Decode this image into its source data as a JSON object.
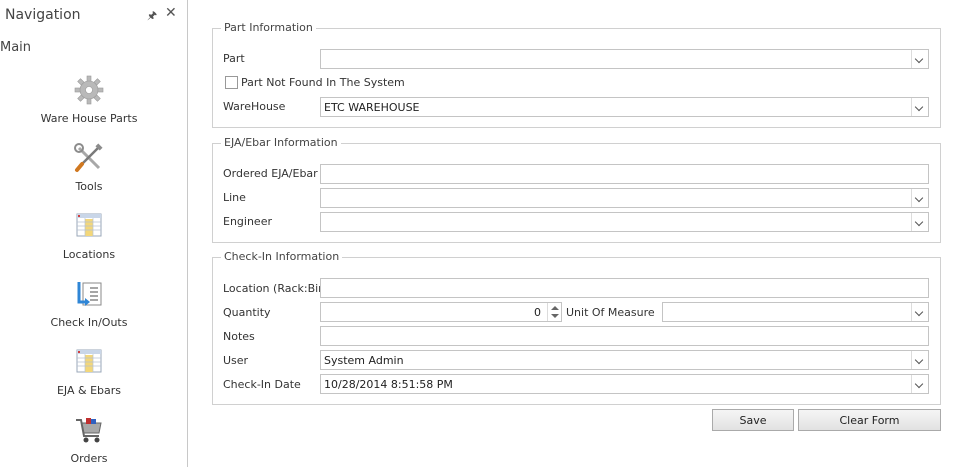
{
  "navigation": {
    "title": "Navigation",
    "group": "Main",
    "items": [
      {
        "label": "Ware House Parts",
        "icon": "gear-icon"
      },
      {
        "label": "Tools",
        "icon": "tools-icon"
      },
      {
        "label": "Locations",
        "icon": "grid-table-icon"
      },
      {
        "label": "Check In/Outs",
        "icon": "check-in-out-icon"
      },
      {
        "label": "EJA & Ebars",
        "icon": "grid-table-icon"
      },
      {
        "label": "Orders",
        "icon": "shopping-cart-icon"
      }
    ]
  },
  "part_info": {
    "title": "Part Information",
    "part_label": "Part",
    "part_value": "",
    "not_found_label": "Part Not Found In The System",
    "not_found_checked": false,
    "warehouse_label": "WareHouse",
    "warehouse_value": "ETC WAREHOUSE"
  },
  "eja_info": {
    "title": "EJA/Ebar Information",
    "ordered_label": "Ordered EJA/Ebar",
    "ordered_value": "",
    "line_label": "Line",
    "line_value": "",
    "engineer_label": "Engineer",
    "engineer_value": ""
  },
  "checkin_info": {
    "title": "Check-In Information",
    "location_label": "Location (Rack:Bin)",
    "location_value": "",
    "quantity_label": "Quantity",
    "quantity_value": "0",
    "uom_label": "Unit Of Measure",
    "uom_value": "",
    "notes_label": "Notes",
    "notes_value": "",
    "user_label": "User",
    "user_value": "System Admin",
    "date_label": "Check-In Date",
    "date_value": "10/28/2014 8:51:58 PM"
  },
  "buttons": {
    "save": "Save",
    "clear": "Clear Form"
  }
}
